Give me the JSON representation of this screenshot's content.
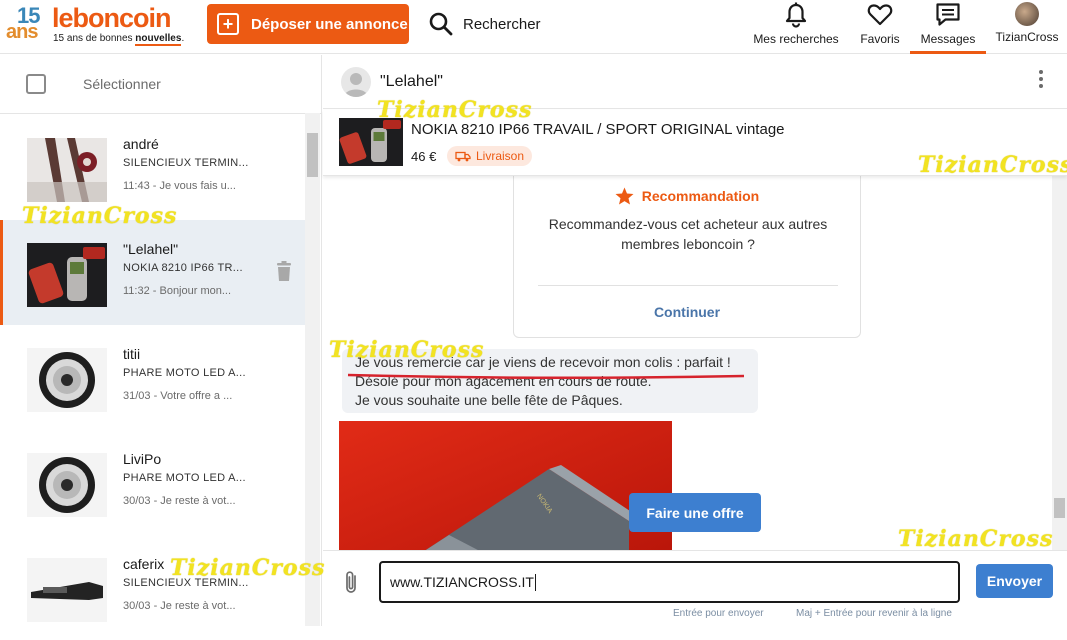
{
  "header": {
    "logo": {
      "number": "15",
      "ans": "ans",
      "brand": "leboncoin",
      "tagline_prefix": "15 ans de bonnes ",
      "tagline_highlight": "nouvelles",
      "tagline_suffix": "."
    },
    "post_button": "Déposer une annonce",
    "search_label": "Rechercher",
    "nav": {
      "searches": "Mes recherches",
      "favorites": "Favoris",
      "messages": "Messages",
      "user": "TizianCross"
    }
  },
  "sidebar": {
    "select_label": "Sélectionner",
    "conversations": [
      {
        "name": "andré",
        "item": "SILENCIEUX TERMIN...",
        "last": "11:43 - Je vous fais u..."
      },
      {
        "name": "\"Lelahel\"",
        "item": "NOKIA 8210 IP66 TR...",
        "last": "11:32 - Bonjour mon..."
      },
      {
        "name": "titii",
        "item": "PHARE MOTO LED A...",
        "last": "31/03 - Votre offre a ..."
      },
      {
        "name": "LiviPo",
        "item": "PHARE MOTO LED A...",
        "last": "30/03 - Je reste à vot..."
      },
      {
        "name": "caferix",
        "item": "SILENCIEUX TERMIN...",
        "last": "30/03 - Je reste à vot..."
      }
    ]
  },
  "chat": {
    "contact_name": "\"Lelahel\"",
    "ad": {
      "title": "NOKIA 8210 IP66 TRAVAIL / SPORT ORIGINAL vintage",
      "price": "46 €",
      "badge": "Livraison"
    },
    "recommendation": {
      "title": "Recommandation",
      "text": "Recommandez-vous cet acheteur aux autres membres leboncoin ?",
      "action": "Continuer"
    },
    "message_lines": [
      "Je vous remercie car je viens de recevoir mon colis : parfait !",
      "Désolé pour mon agacement en cours de route.",
      "Je vous souhaite une belle fête de Pâques."
    ],
    "photo_label": "NOKIA",
    "offer_button": "Faire une offre",
    "composer": {
      "value": "www.TIZIANCROSS.IT",
      "send": "Envoyer",
      "hint_enter": "Entrée pour envoyer",
      "hint_shift": "Maj + Entrée pour revenir à la ligne"
    }
  },
  "watermark": "TizianCross",
  "colors": {
    "brand": "#ec5a13",
    "accent": "#3d7fd0",
    "active_bg": "#e9eef3",
    "watermark": "#f2e321"
  },
  "icons": [
    "plus-icon",
    "search-icon",
    "bell-icon",
    "heart-icon",
    "message-icon",
    "trash-icon",
    "kebab-icon",
    "star-icon",
    "delivery-icon",
    "paperclip-icon"
  ]
}
